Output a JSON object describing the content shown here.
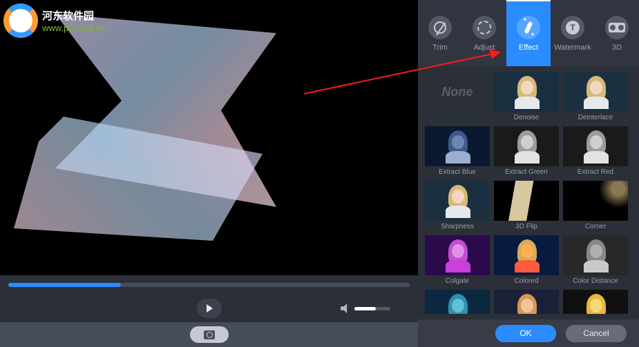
{
  "watermark": {
    "title": "河东软件园",
    "url": "www.pc0359.cn"
  },
  "tabs": [
    {
      "id": "trim",
      "label": "Trim"
    },
    {
      "id": "adjust",
      "label": "Adjust"
    },
    {
      "id": "effect",
      "label": "Effect"
    },
    {
      "id": "watermark",
      "label": "Watermark"
    },
    {
      "id": "3d",
      "label": "3D"
    }
  ],
  "active_tab": "effect",
  "effects": {
    "none_label": "None",
    "items": [
      {
        "label": "",
        "style": "none"
      },
      {
        "label": "Denoise",
        "style": "normal"
      },
      {
        "label": "Deinterlace",
        "style": "normal"
      },
      {
        "label": "Extract Blue",
        "style": "blue"
      },
      {
        "label": "Extract Green",
        "style": "bw"
      },
      {
        "label": "Extract Red",
        "style": "bw"
      },
      {
        "label": "Sharpness",
        "style": "normal"
      },
      {
        "label": "3D Flip",
        "style": "flip"
      },
      {
        "label": "Corner",
        "style": "corner"
      },
      {
        "label": "Colgate",
        "style": "magenta"
      },
      {
        "label": "Colored",
        "style": "redblue"
      },
      {
        "label": "Color Distance",
        "style": "gray"
      },
      {
        "label": "",
        "style": "teal"
      },
      {
        "label": "",
        "style": "warm"
      },
      {
        "label": "",
        "style": "gold"
      }
    ]
  },
  "player": {
    "progress_pct": 28,
    "volume_pct": 60
  },
  "buttons": {
    "ok": "OK",
    "cancel": "Cancel"
  }
}
